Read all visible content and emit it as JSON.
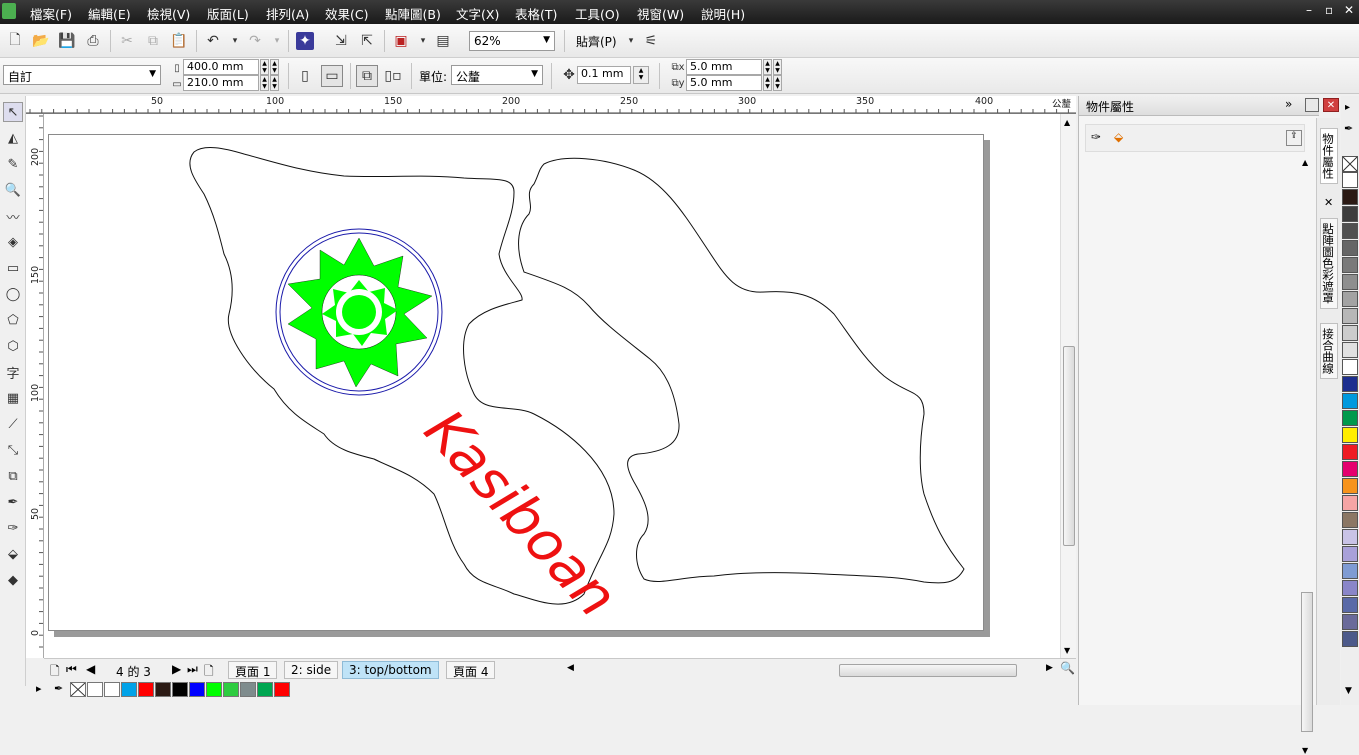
{
  "menu": [
    "檔案(F)",
    "編輯(E)",
    "檢視(V)",
    "版面(L)",
    "排列(A)",
    "效果(C)",
    "點陣圖(B)",
    "文字(X)",
    "表格(T)",
    "工具(O)",
    "視窗(W)",
    "說明(H)"
  ],
  "toolbar": {
    "zoom": "62%",
    "snap": "貼齊(P)"
  },
  "property_bar": {
    "preset": "自訂",
    "width": "400.0 mm",
    "height": "210.0 mm",
    "units_label": "單位:",
    "units": "公釐",
    "nudge": "0.1 mm",
    "dup_x": "5.0 mm",
    "dup_y": "5.0 mm"
  },
  "ruler": {
    "h_ticks": [
      "50",
      "100",
      "150",
      "200",
      "250",
      "300",
      "350",
      "400"
    ],
    "v_ticks": [
      "200",
      "150",
      "100",
      "50",
      "0"
    ],
    "unit": "公釐"
  },
  "artwork": {
    "text": "Kasiboan",
    "text_color": "#ee1111",
    "shape_color": "#00ff00",
    "ring_color": "#1a1aaa"
  },
  "pagebar": {
    "counter": "4 的 3",
    "tabs": [
      "頁面 1",
      "2: side",
      "3: top/bottom",
      "頁面 4"
    ],
    "active_tab": "3: top/bottom"
  },
  "docker": {
    "title": "物件屬性",
    "vtabs": [
      "物件屬性",
      "點陣圖色彩遮罩",
      "接合曲線"
    ]
  },
  "doc_palette": [
    "#00a2e8",
    "#ff0000",
    "#2b1a14",
    "#000000",
    "#0000ff",
    "#00ff00",
    "#2ecc40",
    "#7f8c8d",
    "#00a651",
    "#ff0000"
  ],
  "right_palette": [
    "#ffffff",
    "#2b1a14",
    "#3d3d3d",
    "#505050",
    "#666666",
    "#7a7a7a",
    "#8e8e8e",
    "#a3a3a3",
    "#b7b7b7",
    "#cccccc",
    "#e0e0e0",
    "#ffffff",
    "#1d2f8f",
    "#0099dd",
    "#00994c",
    "#ffee00",
    "#ee1c24",
    "#e4006e",
    "#f7941d",
    "#f6a5a5",
    "#8b7765",
    "#c9c3e6",
    "#a9a1d9",
    "#7f9bd3",
    "#8a86c9",
    "#5a6aa8",
    "#6a6a9a",
    "#4d5a8a"
  ]
}
